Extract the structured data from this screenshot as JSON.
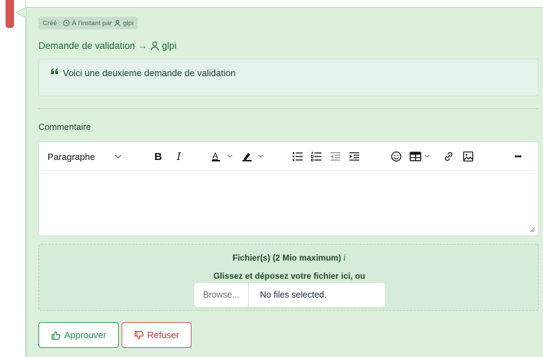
{
  "created": {
    "prefix": "Créé :",
    "when": "À l'instant par",
    "user": "glpi"
  },
  "validation": {
    "label": "Demande de validation",
    "arrow": "→",
    "user": "glpi"
  },
  "quote": {
    "text": "Voici une deuxieme demande de validation"
  },
  "comment": {
    "label": "Commentaire"
  },
  "editor": {
    "paragraph_select": "Paragraphe",
    "bold": "B",
    "italic": "I",
    "more": "•••"
  },
  "dropzone": {
    "title": "Fichier(s) (2 Mio maximum)",
    "info": "i",
    "subtitle": "Glissez et déposez votre fichier ici, ou",
    "browse_label": "Browse...",
    "status": "No files selected."
  },
  "actions": {
    "approve_label": "Approuver",
    "refuse_label": "Refuser"
  },
  "colors": {
    "approve": "#1f8a47",
    "refuse": "#c9302c",
    "card_bg": "#dcf0dc",
    "badge": "#d9534f"
  }
}
